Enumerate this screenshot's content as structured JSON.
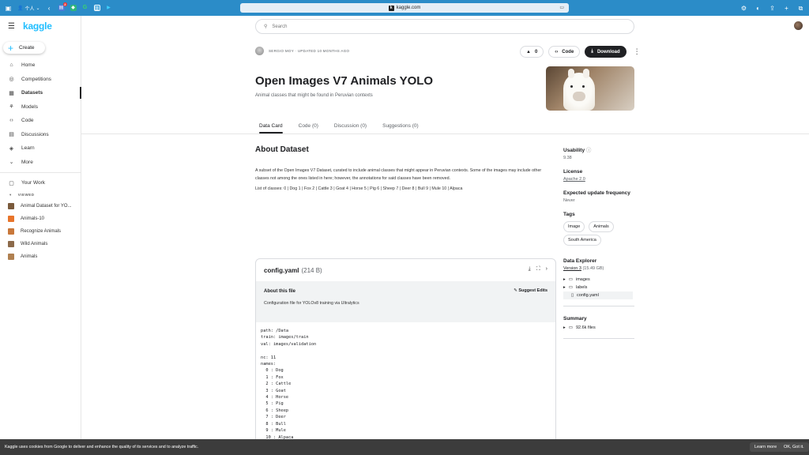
{
  "browser": {
    "url": "kaggle.com",
    "profile": "个人",
    "badge": "2",
    "ext_g": "G"
  },
  "sidebar": {
    "logo": "kaggle",
    "create_label": "Create",
    "items": [
      {
        "label": "Home",
        "icon": "home-icon"
      },
      {
        "label": "Competitions",
        "icon": "trophy-icon"
      },
      {
        "label": "Datasets",
        "icon": "table-icon",
        "active": true
      },
      {
        "label": "Models",
        "icon": "models-icon"
      },
      {
        "label": "Code",
        "icon": "code-icon"
      },
      {
        "label": "Discussions",
        "icon": "discussion-icon"
      },
      {
        "label": "Learn",
        "icon": "learn-icon"
      },
      {
        "label": "More",
        "icon": "chevron-down-icon"
      }
    ],
    "your_work": "Your Work",
    "viewed_header": "VIEWED",
    "viewed": [
      {
        "label": "Animal Dataset for YO...",
        "color": "#7a5a3c"
      },
      {
        "label": "Animals-10",
        "color": "#e8742a"
      },
      {
        "label": "Recognize Animals",
        "color": "#c8773a"
      },
      {
        "label": "Wild Animals",
        "color": "#8c6a4a"
      },
      {
        "label": "Animals",
        "color": "#b08050"
      }
    ]
  },
  "header": {
    "search_placeholder": "Search"
  },
  "dataset": {
    "meta": "SERGIO MOY · UPDATED 10 MONTHS AGO",
    "upvotes": "0",
    "code_label": "Code",
    "download_label": "Download",
    "title": "Open Images V7 Animals YOLO",
    "subtitle": "Animal classes that might be found in Peruvian contexts",
    "tabs": [
      "Data Card",
      "Code (0)",
      "Discussion (0)",
      "Suggestions (0)"
    ],
    "about_heading": "About Dataset",
    "about_text": "A subset of the Open Images V7 Dataset, curated to include animal classes that might appear in Peruvian contexts. Some of the images may include other classes not among the ones listed in here; however, the annotations for said classes have been removed.",
    "classes_text": "List of classes: 0 | Dog 1 | Fox 2 | Cattle 3 | Goat 4 | Horse 5 | Pig 6 | Sheep 7 | Deer 8 | Bull 9 | Mule 10 | Alpaca"
  },
  "file": {
    "name": "config.yaml",
    "size": "(214 B)",
    "about_heading": "About this file",
    "suggest_edits": "Suggest Edits",
    "description": "Configuration file for YOLOv8 training via Ultralytics",
    "code": "path: /Data\ntrain: images/train\nval: images/validation\n\nnc: 11\nnames:\n  0 : Dog\n  1 : Fox\n  2 : Cattle\n  3 : Goat\n  4 : Horse\n  5 : Pig\n  6 : Sheep\n  7 : Deer\n  8 : Bull\n  9 : Mule\n  10 : Alpaca"
  },
  "right_panel": {
    "usability_label": "Usability",
    "usability_value": "9.38",
    "license_label": "License",
    "license_value": "Apache 2.0",
    "update_label": "Expected update frequency",
    "update_value": "Never",
    "tags_label": "Tags",
    "tags": [
      "Image",
      "Animals",
      "South America"
    ],
    "explorer_label": "Data Explorer",
    "version_link": "Version 3",
    "version_size": "(15.49 GB)",
    "tree": [
      "images",
      "labels",
      "config.yaml"
    ],
    "summary_label": "Summary",
    "summary_files": "92.6k files"
  },
  "cookie": {
    "text": "Kaggle uses cookies from Google to deliver and enhance the quality of its services and to analyze traffic.",
    "learn_more": "Learn more",
    "ok": "OK, Got it."
  },
  "colors": {
    "chrome": "#2b8cc8",
    "kaggle_blue": "#20beff",
    "dark_button": "#202124",
    "cookie_bar": "#3c3c3c"
  }
}
